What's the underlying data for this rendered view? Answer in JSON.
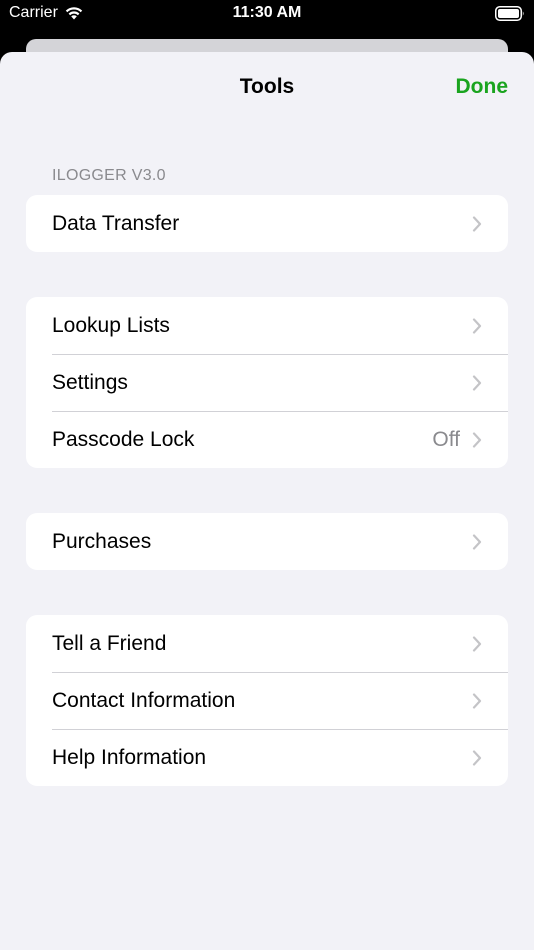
{
  "status_bar": {
    "carrier": "Carrier",
    "time": "11:30 AM"
  },
  "nav": {
    "title": "Tools",
    "done_label": "Done"
  },
  "section_header": "ILOGGER V3.0",
  "groups": [
    {
      "rows": [
        {
          "label": "Data Transfer"
        }
      ]
    },
    {
      "rows": [
        {
          "label": "Lookup Lists"
        },
        {
          "label": "Settings"
        },
        {
          "label": "Passcode Lock",
          "value": "Off"
        }
      ]
    },
    {
      "rows": [
        {
          "label": "Purchases"
        }
      ]
    },
    {
      "rows": [
        {
          "label": "Tell a Friend"
        },
        {
          "label": "Contact Information"
        },
        {
          "label": "Help Information"
        }
      ]
    }
  ],
  "colors": {
    "accent": "#1aa41f",
    "background": "#f2f2f7",
    "secondary_text": "#8a8a8e"
  }
}
